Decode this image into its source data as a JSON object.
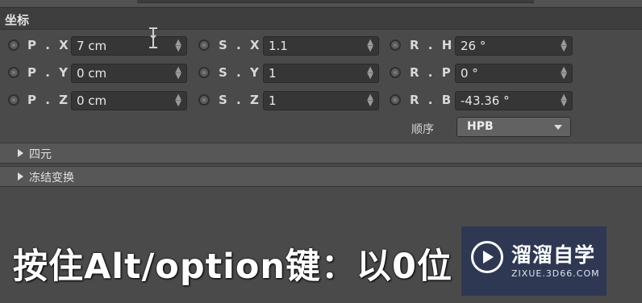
{
  "section": {
    "title": "坐标"
  },
  "rows": [
    {
      "position": {
        "label": "P . X",
        "value": "7 cm"
      },
      "scale": {
        "label": "S . X",
        "value": "1.1"
      },
      "rotation": {
        "label": "R . H",
        "value": "26 °"
      }
    },
    {
      "position": {
        "label": "P . Y",
        "value": "0 cm"
      },
      "scale": {
        "label": "S . Y",
        "value": "1"
      },
      "rotation": {
        "label": "R . P",
        "value": "0 °"
      }
    },
    {
      "position": {
        "label": "P . Z",
        "value": "0 cm"
      },
      "scale": {
        "label": "S . Z",
        "value": "1"
      },
      "rotation": {
        "label": "R . B",
        "value": "-43.36 °"
      }
    }
  ],
  "order": {
    "label": "顺序",
    "value": "HPB"
  },
  "collapsed_sections": [
    "四元",
    "冻结变换"
  ],
  "subtitle": "按住Alt/option键：以0位",
  "watermark": {
    "name": "溜溜自学",
    "url": "ZIXUE.3D66.COM"
  }
}
